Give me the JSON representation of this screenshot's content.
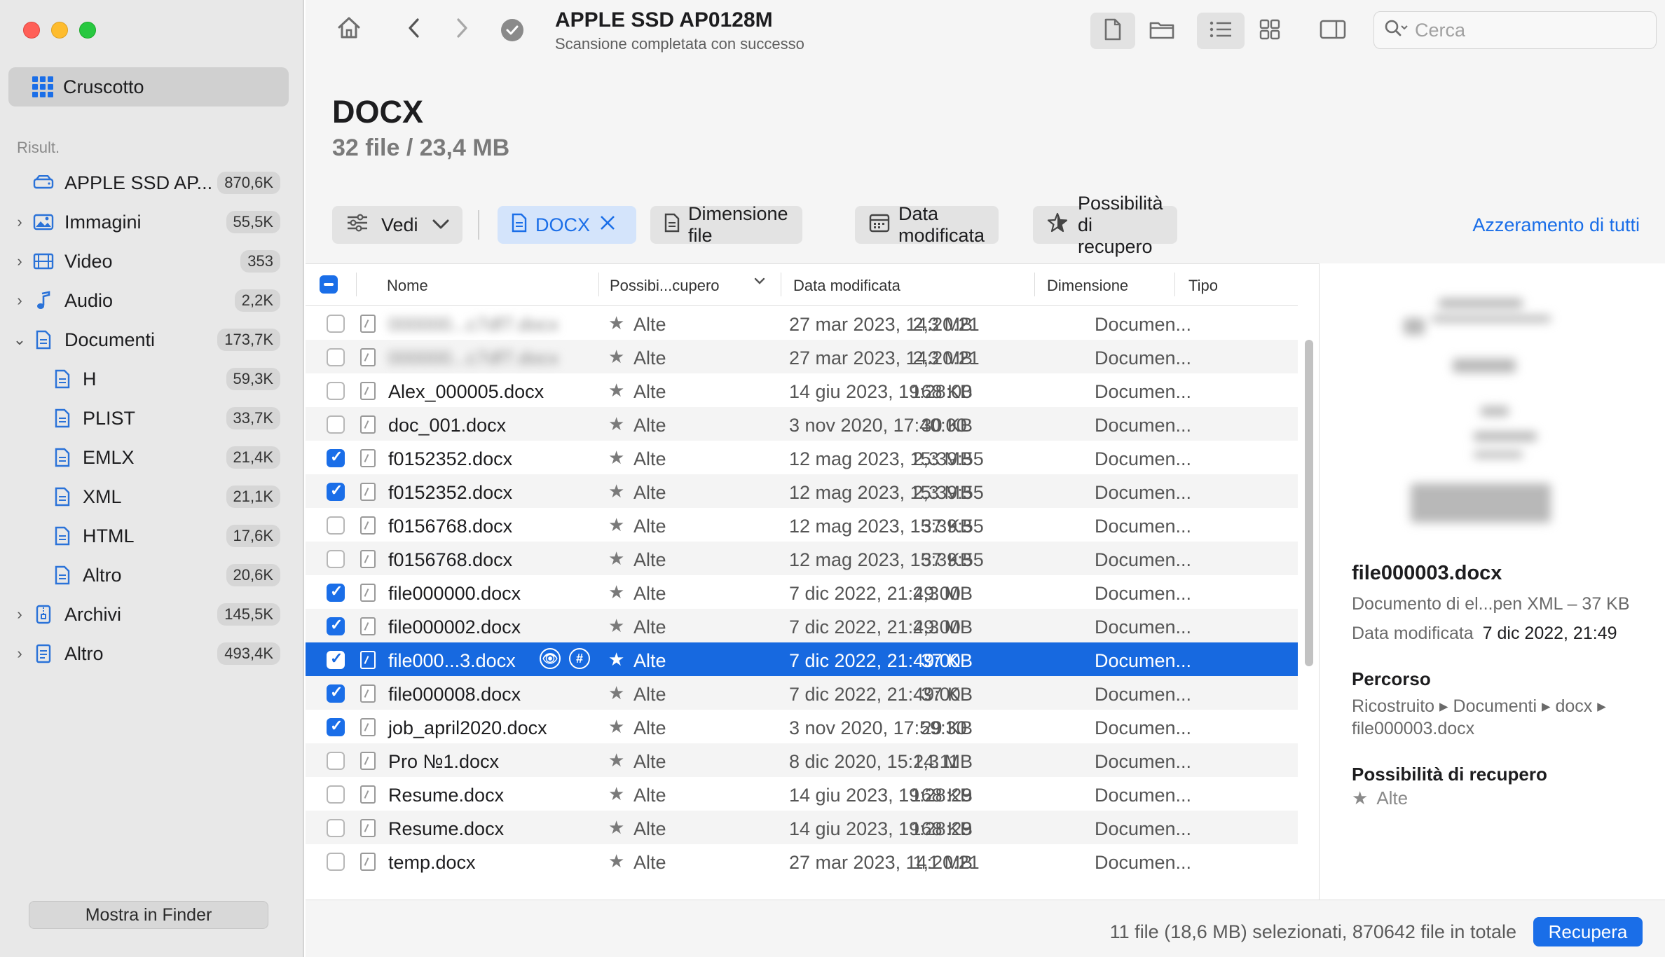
{
  "sidebar": {
    "dashboard_label": "Cruscotto",
    "results_label": "Risult.",
    "items": [
      {
        "label": "APPLE SSD AP...",
        "count": "870,6K",
        "icon": "drive-icon"
      },
      {
        "label": "Immagini",
        "count": "55,5K",
        "icon": "photo-icon"
      },
      {
        "label": "Video",
        "count": "353",
        "icon": "film-icon"
      },
      {
        "label": "Audio",
        "count": "2,2K",
        "icon": "music-note-icon"
      },
      {
        "label": "Documenti",
        "count": "173,7K",
        "icon": "document-icon"
      },
      {
        "label": "H",
        "count": "59,3K",
        "icon": "document-icon"
      },
      {
        "label": "PLIST",
        "count": "33,7K",
        "icon": "document-icon"
      },
      {
        "label": "EMLX",
        "count": "21,4K",
        "icon": "document-icon"
      },
      {
        "label": "XML",
        "count": "21,1K",
        "icon": "document-icon"
      },
      {
        "label": "HTML",
        "count": "17,6K",
        "icon": "document-icon"
      },
      {
        "label": "Altro",
        "count": "20,6K",
        "icon": "document-icon"
      },
      {
        "label": "Archivi",
        "count": "145,5K",
        "icon": "archive-icon"
      },
      {
        "label": "Altro",
        "count": "493,4K",
        "icon": "document-icon"
      }
    ],
    "finder_button": "Mostra in Finder"
  },
  "toolbar": {
    "drive_title": "APPLE SSD AP0128M",
    "drive_status": "Scansione completata con successo",
    "search_placeholder": "Cerca"
  },
  "header": {
    "title": "DOCX",
    "subtitle": "32 file / 23,4 MB"
  },
  "filters": {
    "view_label": "Vedi",
    "docx_label": "DOCX",
    "size_label": "Dimensione file",
    "date_label": "Data modificata",
    "chance_label": "Possibilità di recupero",
    "reset_label": "Azzeramento di tutti"
  },
  "table": {
    "columns": {
      "name": "Nome",
      "chance": "Possibi...cupero",
      "date": "Data modificata",
      "size": "Dimensione",
      "type": "Tipo"
    },
    "rows": [
      {
        "name": "000000...c7df7.docx",
        "chance": "Alte",
        "date": "27 mar 2023, 14:20:21",
        "size": "2,3 MB",
        "type": "Documen..."
      },
      {
        "name": "000000...c7df7.docx",
        "chance": "Alte",
        "date": "27 mar 2023, 14:20:21",
        "size": "2,3 MB",
        "type": "Documen..."
      },
      {
        "name": "Alex_000005.docx",
        "chance": "Alte",
        "date": "14 giu 2023, 19:28:00",
        "size": "168 KB",
        "type": "Documen..."
      },
      {
        "name": "doc_001.docx",
        "chance": "Alte",
        "date": "3 nov 2020, 17:40:00",
        "size": "30 KB",
        "type": "Documen..."
      },
      {
        "name": "f0152352.docx",
        "chance": "Alte",
        "date": "12 mag 2023, 15:39:55",
        "size": "2,3 MB",
        "type": "Documen..."
      },
      {
        "name": "f0152352.docx",
        "chance": "Alte",
        "date": "12 mag 2023, 15:39:55",
        "size": "2,3 MB",
        "type": "Documen..."
      },
      {
        "name": "f0156768.docx",
        "chance": "Alte",
        "date": "12 mag 2023, 15:39:55",
        "size": "37 KB",
        "type": "Documen..."
      },
      {
        "name": "f0156768.docx",
        "chance": "Alte",
        "date": "12 mag 2023, 15:39:55",
        "size": "37 KB",
        "type": "Documen..."
      },
      {
        "name": "file000000.docx",
        "chance": "Alte",
        "date": "7 dic 2022, 21:49:00",
        "size": "2,3 MB",
        "type": "Documen..."
      },
      {
        "name": "file000002.docx",
        "chance": "Alte",
        "date": "7 dic 2022, 21:49:00",
        "size": "2,3 MB",
        "type": "Documen..."
      },
      {
        "name": "file000...3.docx",
        "chance": "Alte",
        "date": "7 dic 2022, 21:49:00",
        "size": "37 KB",
        "type": "Documen..."
      },
      {
        "name": "file000008.docx",
        "chance": "Alte",
        "date": "7 dic 2022, 21:49:00",
        "size": "37 KB",
        "type": "Documen..."
      },
      {
        "name": "job_april2020.docx",
        "chance": "Alte",
        "date": "3 nov 2020, 17:59:30",
        "size": "29 KB",
        "type": "Documen..."
      },
      {
        "name": "Pro №1.docx",
        "chance": "Alte",
        "date": "8 dic 2020, 15:24:11",
        "size": "1,3 MB",
        "type": "Documen..."
      },
      {
        "name": "Resume.docx",
        "chance": "Alte",
        "date": "14 giu 2023, 19:28:29",
        "size": "168 KB",
        "type": "Documen..."
      },
      {
        "name": "Resume.docx",
        "chance": "Alte",
        "date": "14 giu 2023, 19:28:29",
        "size": "168 KB",
        "type": "Documen..."
      },
      {
        "name": "temp.docx",
        "chance": "Alte",
        "date": "27 mar 2023, 14:20:21",
        "size": "1,1 MB",
        "type": "Documen..."
      }
    ]
  },
  "preview": {
    "file_name": "file000003.docx",
    "description": "Documento di el...pen XML – 37 KB",
    "modified_label": "Data modificata",
    "modified_value": "7 dic 2022, 21:49",
    "path_heading": "Percorso",
    "path_value": "Ricostruito ▸ Documenti ▸ docx ▸ file000003.docx",
    "chance_heading": "Possibilità di recupero",
    "chance_value": "Alte"
  },
  "footer": {
    "status": "11 file (18,6 MB) selezionati, 870642 file in totale",
    "recover_button": "Recupera"
  },
  "colors": {
    "accent": "#1a6ee8",
    "selected_row": "#1769e0"
  }
}
